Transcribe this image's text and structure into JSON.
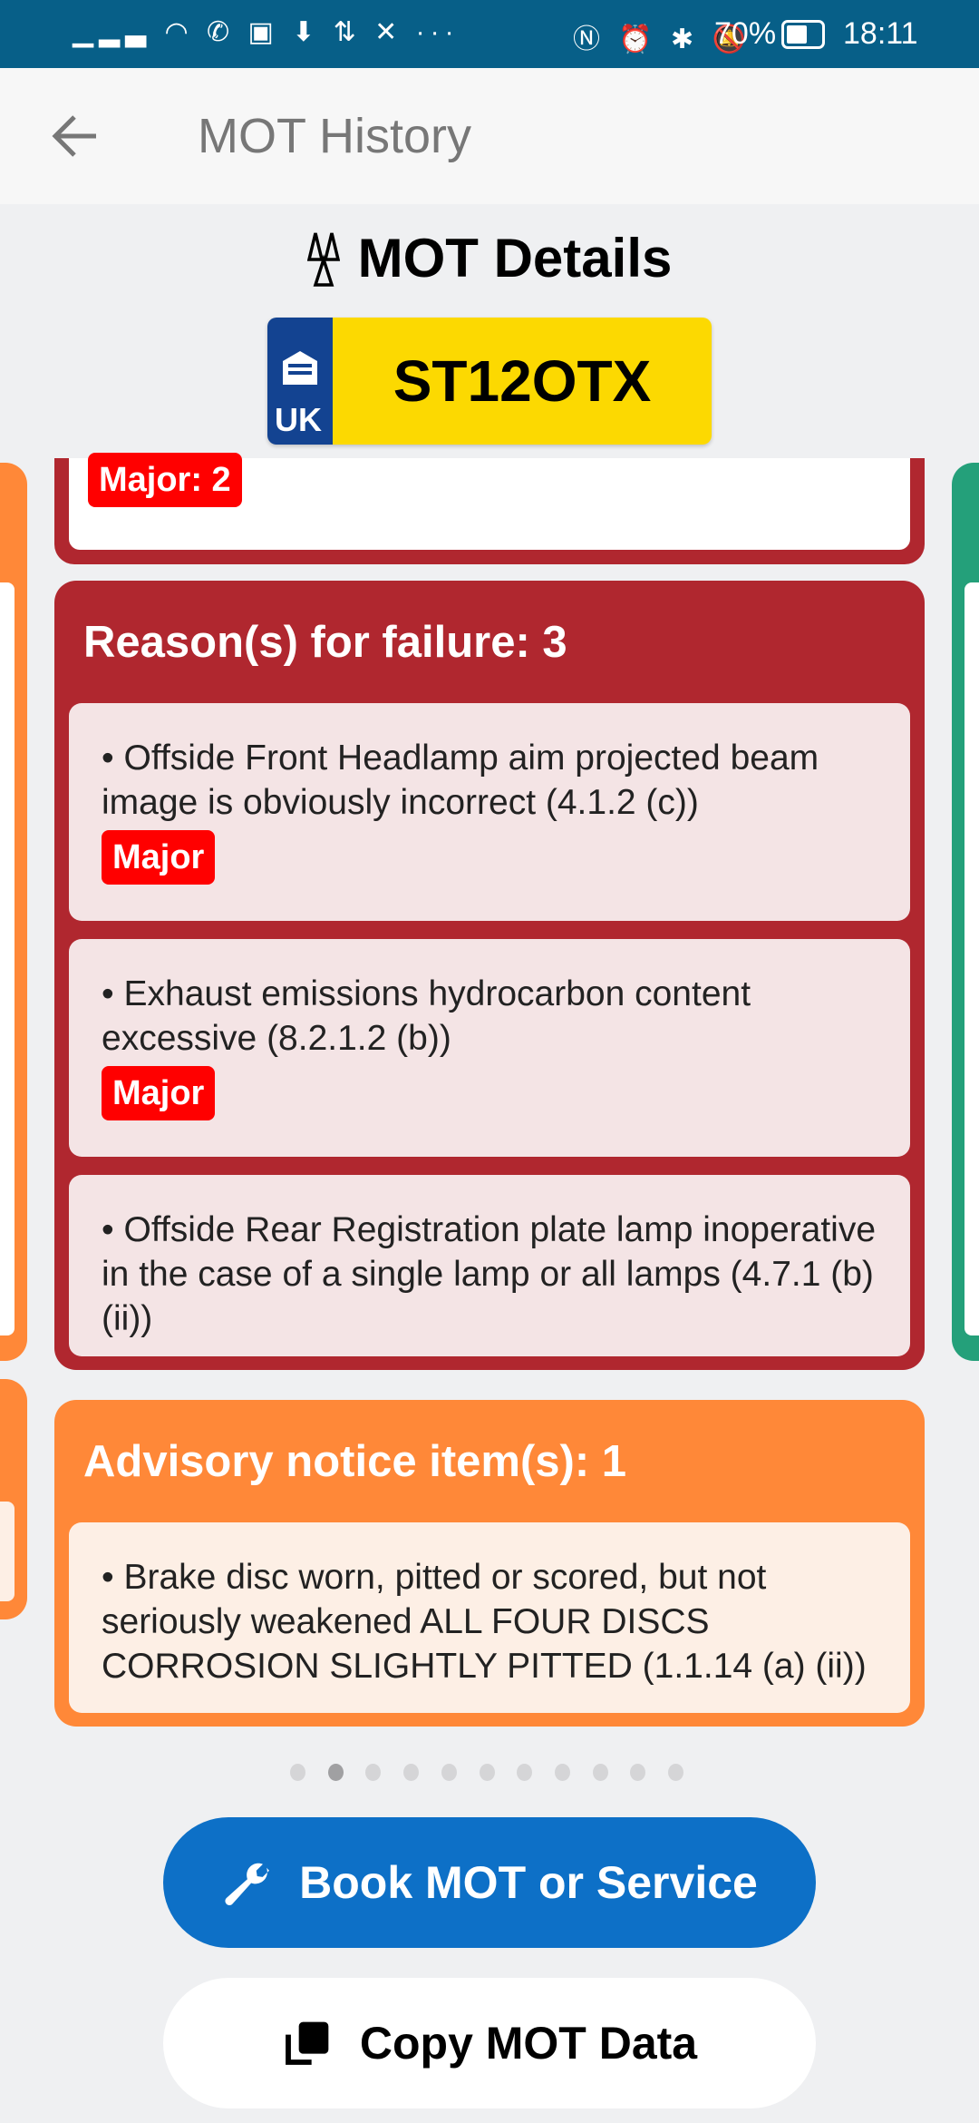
{
  "status_bar": {
    "battery": "70%",
    "time": "18:11",
    "icons": [
      "signal-icon",
      "wifi-icon",
      "whatsapp-icon",
      "outlook-icon",
      "download-icon",
      "data-arrows-icon",
      "halifax-icon",
      "more-icon",
      "nfc-icon",
      "alarm-icon",
      "bluetooth-icon",
      "mute-icon",
      "battery-icon"
    ]
  },
  "app_bar": {
    "title": "MOT History",
    "back_icon": "arrow-left-icon"
  },
  "header": {
    "title": "MOT Details",
    "plate_country": "UK",
    "plate_number": "ST12OTX"
  },
  "previous_card": {
    "badge": "Major: 2"
  },
  "failure_card": {
    "title": "Reason(s) for failure: 3",
    "color": "#b0272f",
    "items": [
      {
        "text": "•  Offside Front Headlamp aim projected beam image is obviously incorrect (4.1.2 (c))",
        "badge": "Major"
      },
      {
        "text": "•  Exhaust emissions hydrocarbon content excessive (8.2.1.2 (b))",
        "badge": "Major"
      },
      {
        "text": "•  Offside Rear Registration plate lamp inoperative in the case of a single lamp or all lamps (4.7.1 (b) (ii))"
      }
    ]
  },
  "advisory_card": {
    "title": "Advisory notice item(s): 1",
    "color": "#ff8838",
    "items": [
      {
        "text": "•  Brake disc worn, pitted or scored, but not seriously weakened  ALL FOUR DISCS CORROSION SLIGHTLY PITTED (1.1.14 (a) (ii))"
      }
    ]
  },
  "pager": {
    "count": 11,
    "active_index": 1
  },
  "buttons": {
    "book": "Book MOT or Service",
    "copy": "Copy MOT Data"
  }
}
